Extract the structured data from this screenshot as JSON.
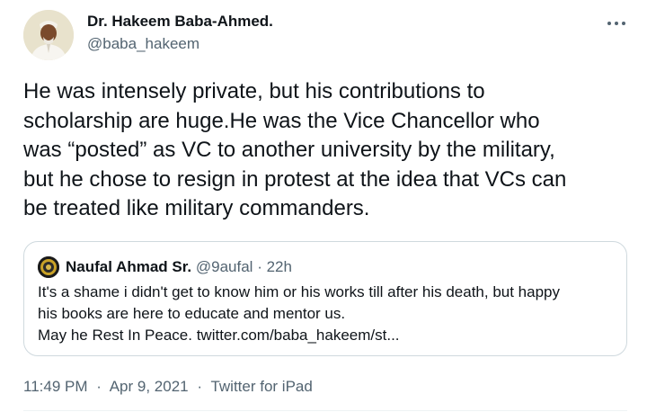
{
  "author": {
    "display_name": "Dr. Hakeem Baba-Ahmed.",
    "handle": "@baba_hakeem"
  },
  "tweet": {
    "text": "He was intensely private, but his contributions to\nscholarship are huge.He was the Vice Chancellor who\nwas “posted” as VC to another university by the military,\nbut he chose to resign in protest at the idea that VCs can\nbe treated like military commanders."
  },
  "quoted_tweet": {
    "display_name": "Naufal Ahmad Sr.",
    "handle": "@9aufal",
    "separator": "·",
    "age": "22h",
    "lines": [
      "It's a shame i didn't get to know him or his works till after his death, but happy",
      "his books are here to educate and mentor us.",
      "May he Rest In Peace. twitter.com/baba_hakeem/st..."
    ]
  },
  "meta": {
    "time": "11:49 PM",
    "separator": "·",
    "date": "Apr 9, 2021",
    "source": "Twitter for iPad"
  },
  "icons": {
    "more": "more-horizontal-icon"
  },
  "colors": {
    "text": "#0f1419",
    "secondary": "#536471",
    "border": "#cfd9de"
  }
}
